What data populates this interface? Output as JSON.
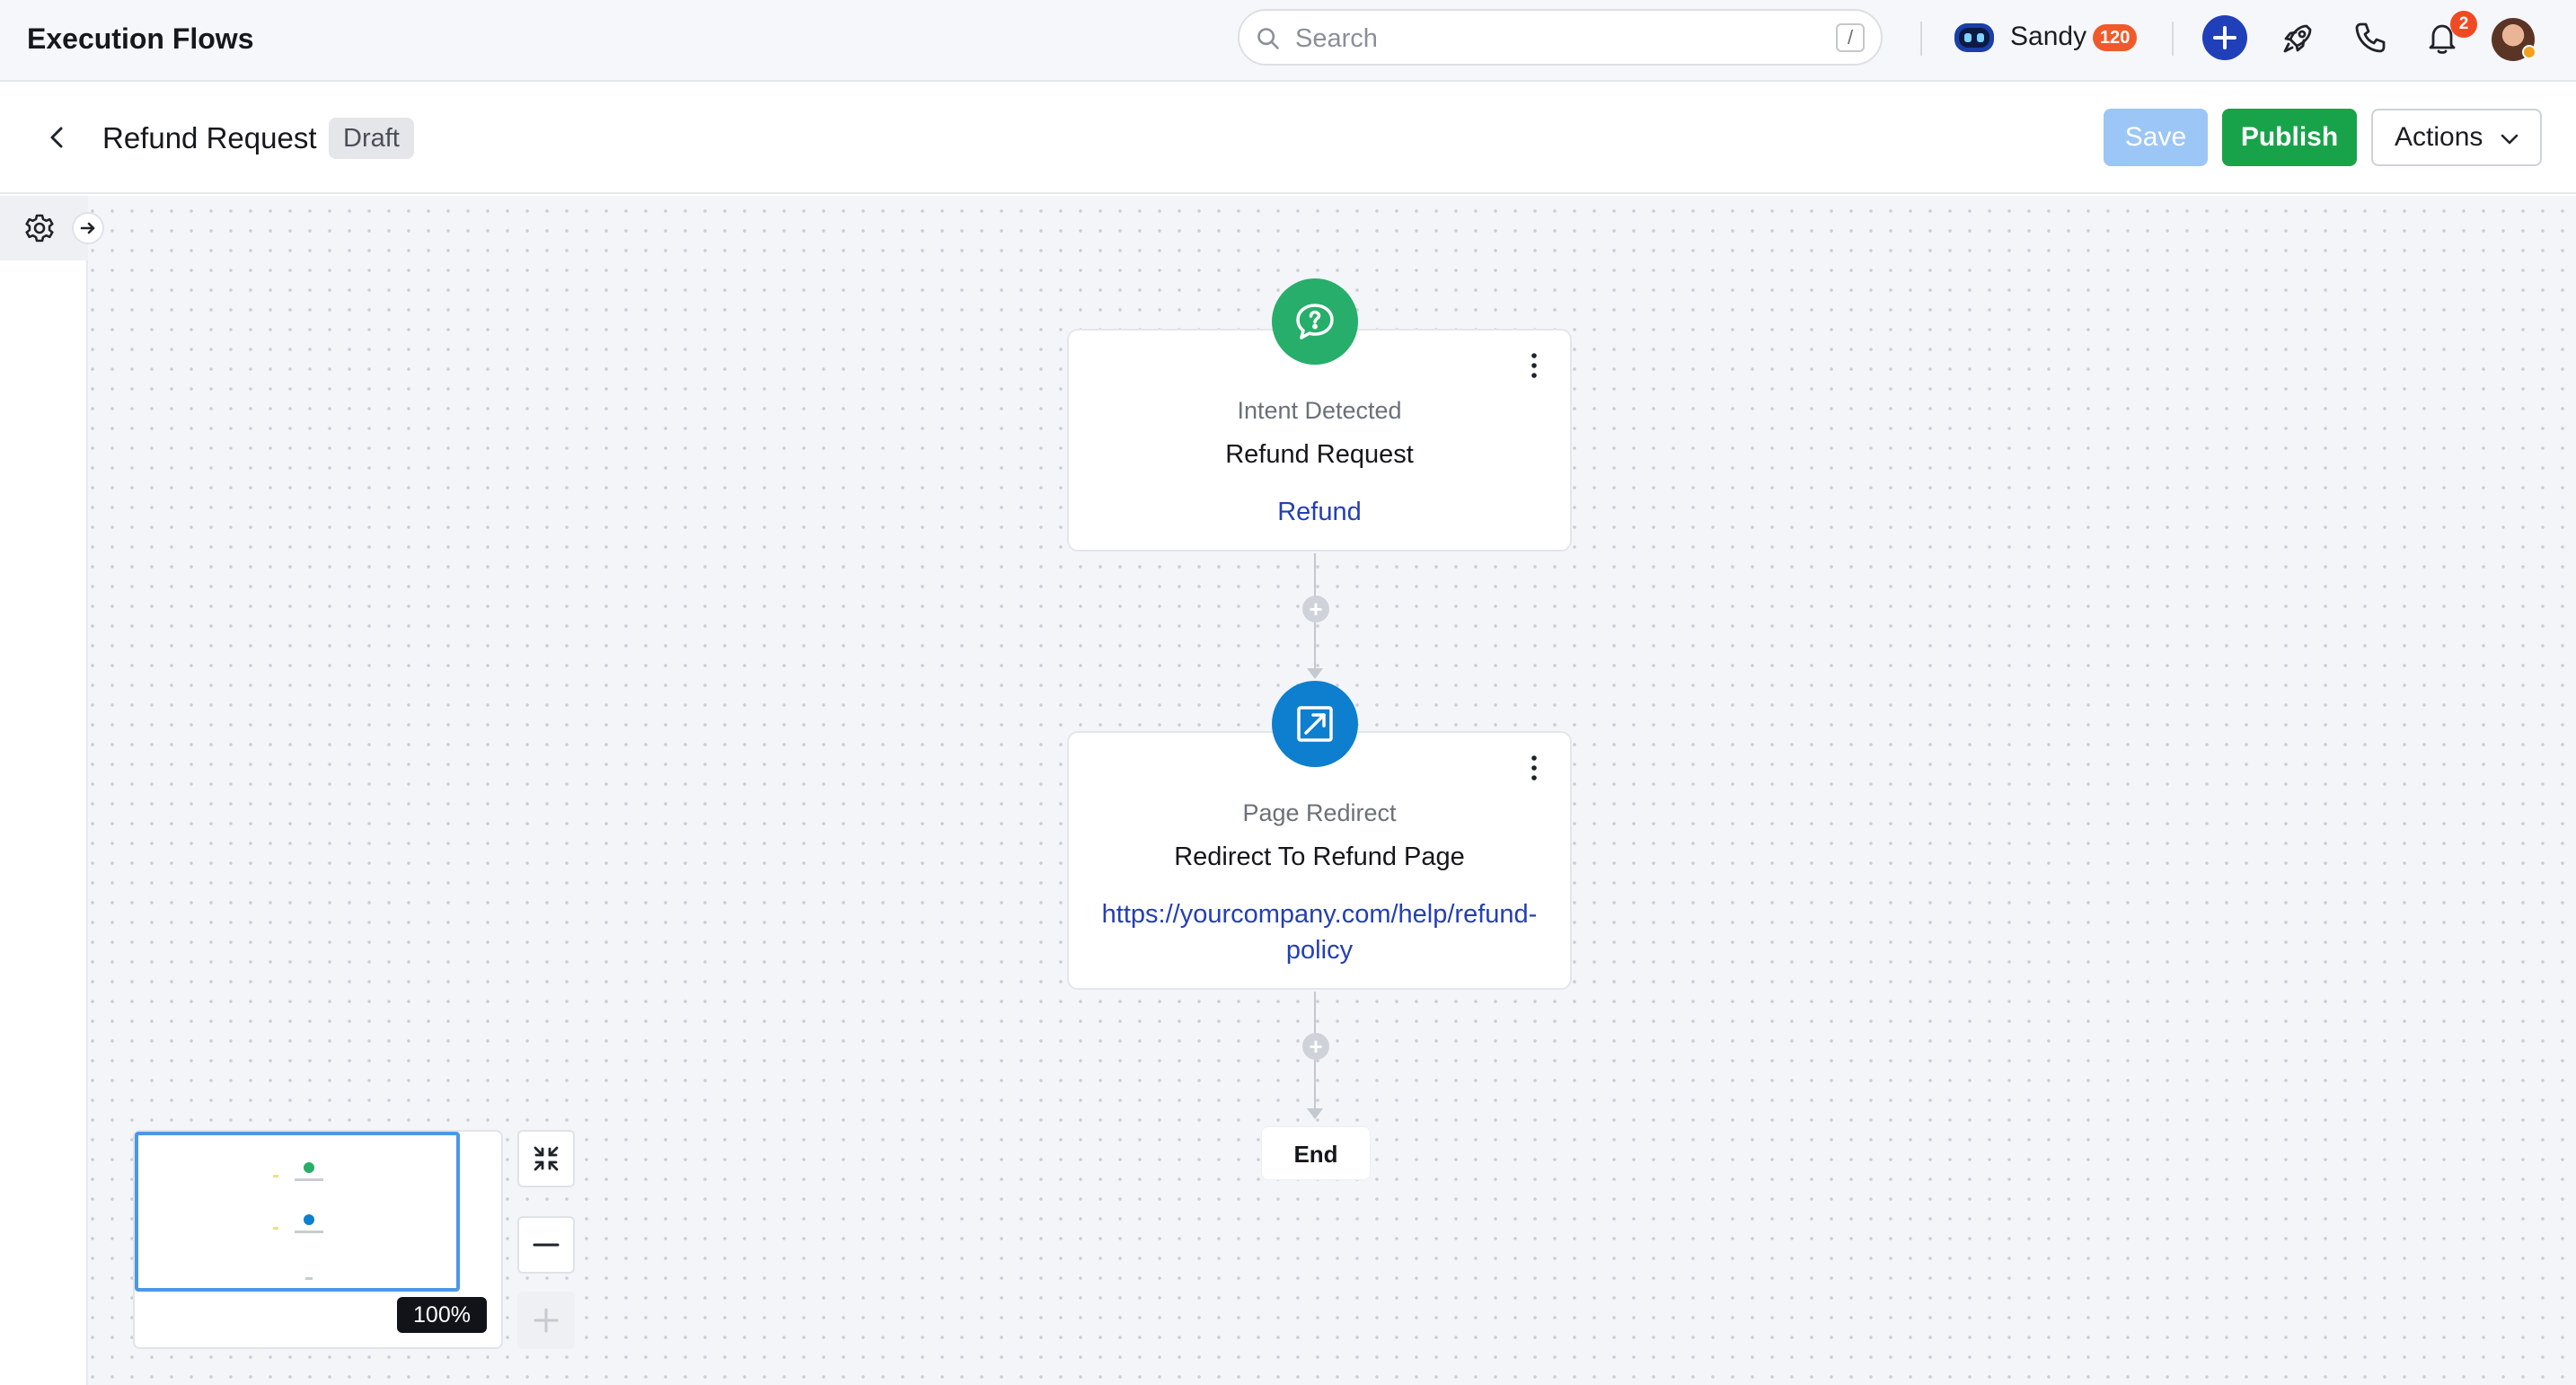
{
  "topbar": {
    "app_title": "Execution Flows",
    "search_placeholder": "Search",
    "search_shortcut": "/",
    "user_name": "Sandy",
    "user_points": "120",
    "notification_count": "2"
  },
  "header": {
    "back_icon": "chevron-left-icon",
    "title": "Refund Request",
    "status": "Draft",
    "save_label": "Save",
    "publish_label": "Publish",
    "actions_label": "Actions"
  },
  "flow": {
    "nodes": [
      {
        "icon": "chat-question-icon",
        "type": "Intent Detected",
        "name": "Refund Request",
        "value": "Refund",
        "color": "#27ae6a"
      },
      {
        "icon": "redirect-arrow-icon",
        "type": "Page Redirect",
        "name": "Redirect To Refund Page",
        "value": "https://yourcompany.com/help/refund-policy",
        "color": "#0e7fcf"
      }
    ],
    "end_label": "End"
  },
  "minimap": {
    "zoom_label": "100%"
  },
  "colors": {
    "accent_blue": "#1f40b8",
    "publish_green": "#18a34a",
    "save_disabled": "#9cc6f5",
    "link_blue": "#243fb3",
    "badge_orange": "#f05a2a"
  }
}
